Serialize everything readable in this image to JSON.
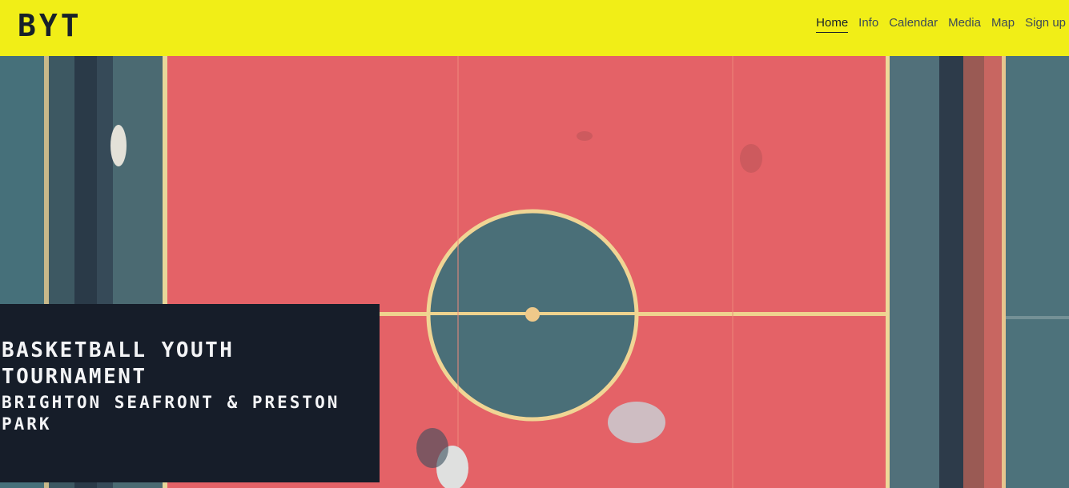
{
  "brand": {
    "logo": "BYT"
  },
  "nav": {
    "items": [
      {
        "label": "Home",
        "active": true
      },
      {
        "label": "Info"
      },
      {
        "label": "Calendar"
      },
      {
        "label": "Media"
      },
      {
        "label": "Map"
      },
      {
        "label": "Sign up"
      }
    ]
  },
  "hero": {
    "title": "BASKETBALL YOUTH TOURNAMENT",
    "subtitle": "BRIGHTON SEAFRONT & PRESTON PARK"
  },
  "colors": {
    "header_bg": "#f1ee17",
    "court_red": "#e9646a",
    "court_teal": "#4a6f78",
    "caption_bg": "#161d29"
  }
}
